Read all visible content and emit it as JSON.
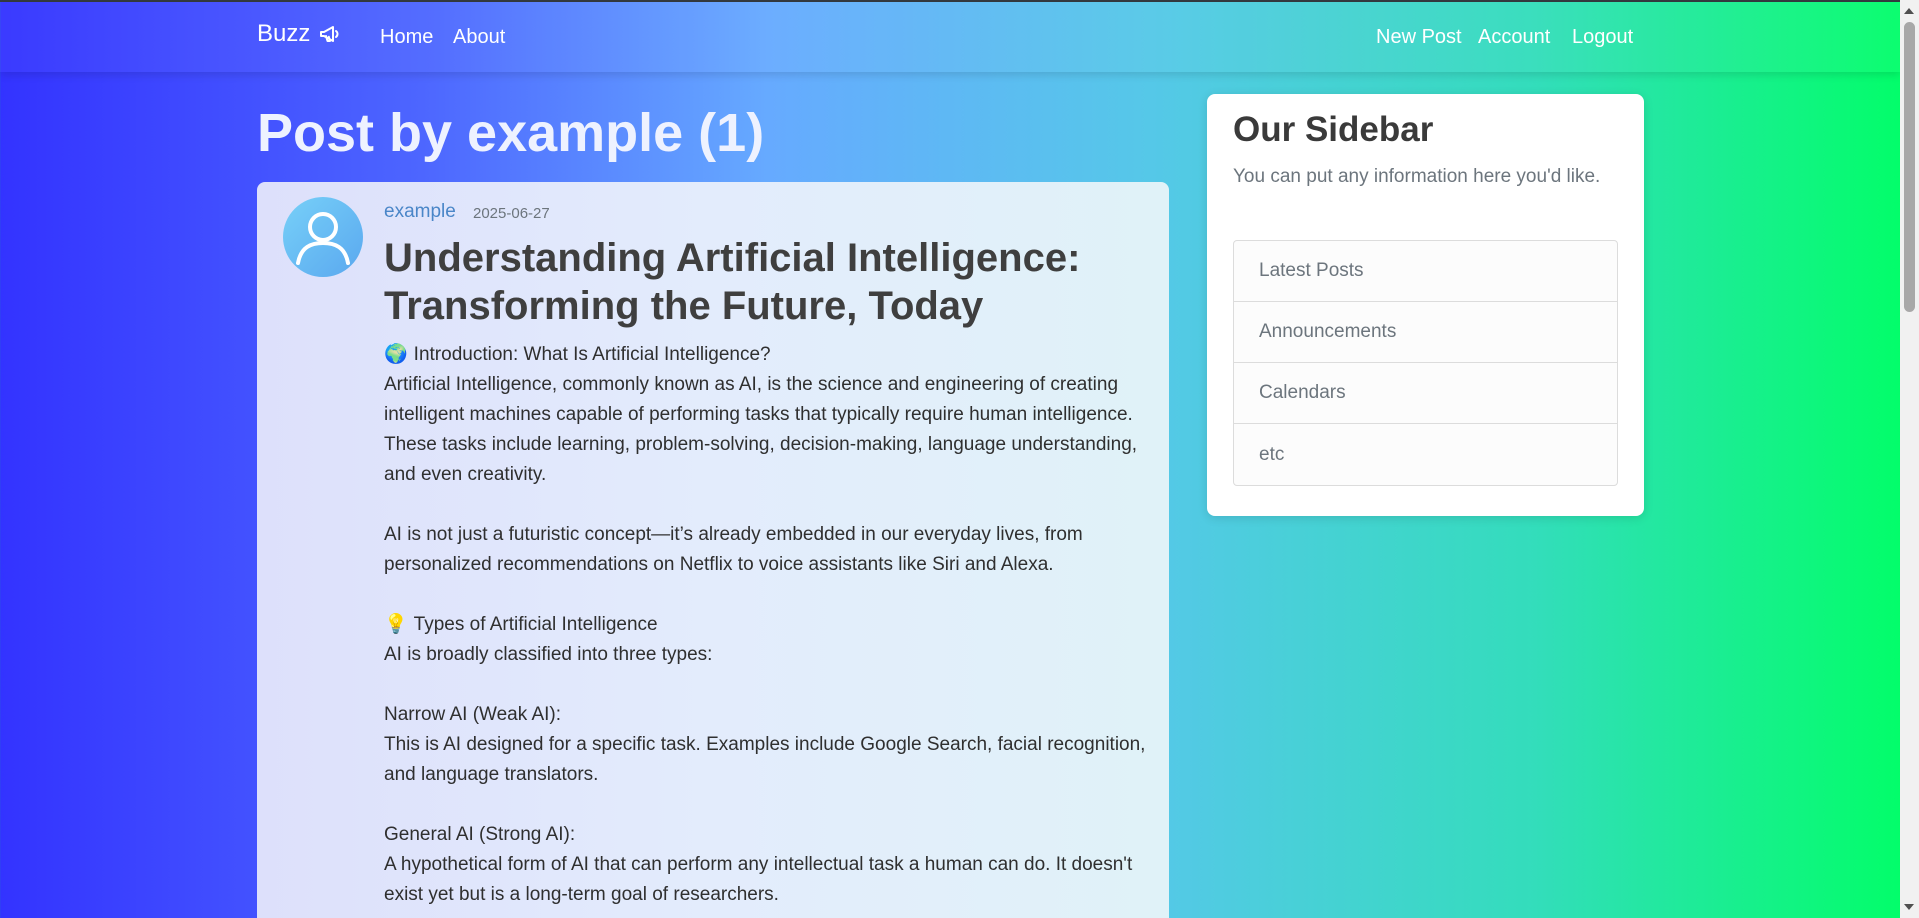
{
  "nav": {
    "brand": "Buzz",
    "brand_icon": "megaphone-icon",
    "home": "Home",
    "about": "About",
    "new_post": "New Post",
    "account": "Account",
    "logout": "Logout"
  },
  "page": {
    "title": "Post by example (1)"
  },
  "post": {
    "author": "example",
    "date": "2025-06-27",
    "avatar_icon": "user-avatar-icon",
    "title": "Understanding Artificial Intelligence: Transforming the Future, Today",
    "body": [
      {
        "emoji": "🌍",
        "text": "Introduction: What Is Artificial Intelligence?"
      },
      {
        "emoji": "",
        "text": "Artificial Intelligence, commonly known as AI, is the science and engineering of creating intelligent machines capable of performing tasks that typically require human intelligence. These tasks include learning, problem-solving, decision-making, language understanding, and even creativity."
      },
      {
        "emoji": "",
        "text": ""
      },
      {
        "emoji": "",
        "text": "AI is not just a futuristic concept—it’s already embedded in our everyday lives, from personalized recommendations on Netflix to voice assistants like Siri and Alexa."
      },
      {
        "emoji": "",
        "text": ""
      },
      {
        "emoji": "💡",
        "text": "Types of Artificial Intelligence"
      },
      {
        "emoji": "",
        "text": "AI is broadly classified into three types:"
      },
      {
        "emoji": "",
        "text": ""
      },
      {
        "emoji": "",
        "text": "Narrow AI (Weak AI):"
      },
      {
        "emoji": "",
        "text": "This is AI designed for a specific task. Examples include Google Search, facial recognition, and language translators."
      },
      {
        "emoji": "",
        "text": ""
      },
      {
        "emoji": "",
        "text": "General AI (Strong AI):"
      },
      {
        "emoji": "",
        "text": "A hypothetical form of AI that can perform any intellectual task a human can do. It doesn't exist yet but is a long-term goal of researchers."
      }
    ]
  },
  "sidebar": {
    "title": "Our Sidebar",
    "description": "You can put any information here you'd like.",
    "items": [
      {
        "label": "Latest Posts"
      },
      {
        "label": "Announcements"
      },
      {
        "label": "Calendars"
      },
      {
        "label": "etc"
      }
    ]
  },
  "colors": {
    "gradient_start": "#3333ff",
    "gradient_mid": "#66aaff",
    "gradient_end": "#00ff66",
    "author_link": "#4a86c8"
  }
}
